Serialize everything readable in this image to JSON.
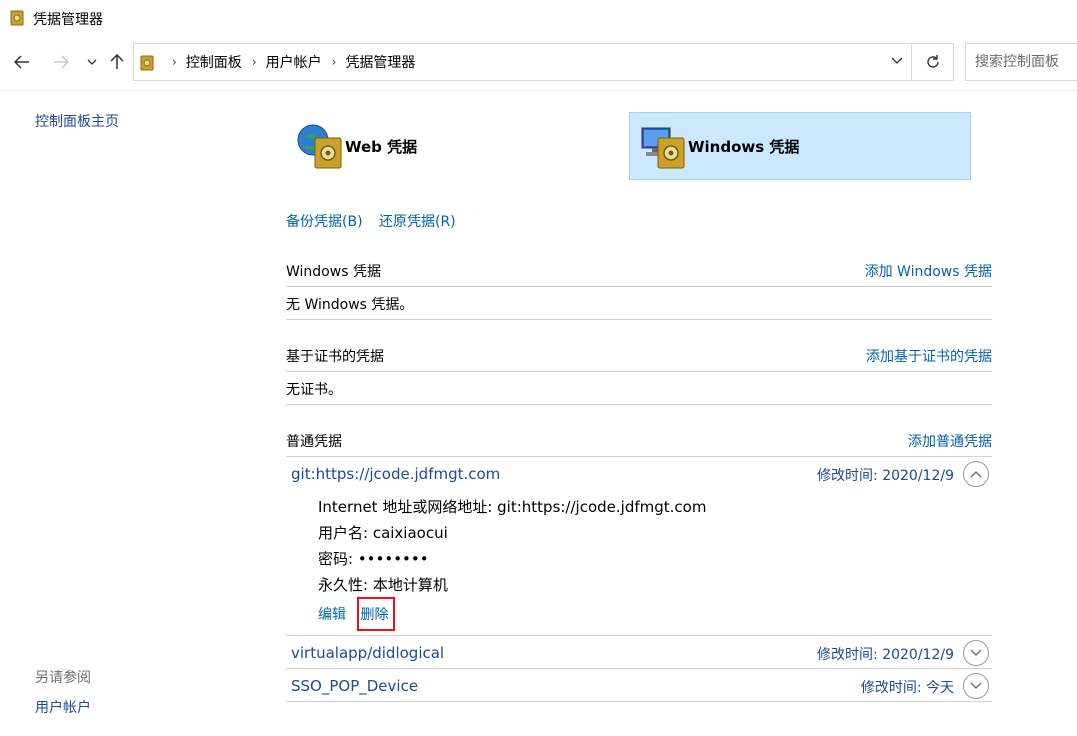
{
  "window": {
    "title": "凭据管理器"
  },
  "address": {
    "breadcrumbs": [
      "控制面板",
      "用户帐户",
      "凭据管理器"
    ],
    "search_placeholder": "搜索控制面板"
  },
  "left": {
    "home_link": "控制面板主页",
    "see_also_label": "另请参阅",
    "see_also_link": "用户帐户"
  },
  "tiles": {
    "web_label": "Web 凭据",
    "windows_label": "Windows 凭据"
  },
  "actions": {
    "backup": "备份凭据(B)",
    "restore": "还原凭据(R)"
  },
  "sections": {
    "windows": {
      "title": "Windows 凭据",
      "add": "添加 Windows 凭据",
      "empty": "无 Windows 凭据。"
    },
    "cert": {
      "title": "基于证书的凭据",
      "add": "添加基于证书的凭据",
      "empty": "无证书。"
    },
    "generic": {
      "title": "普通凭据",
      "add": "添加普通凭据"
    }
  },
  "credentials": [
    {
      "name": "git:https://jcode.jdfmgt.com",
      "modified": "修改时间:  2020/12/9",
      "expanded": true,
      "details": {
        "address": "Internet 地址或网络地址:  git:https://jcode.jdfmgt.com",
        "username": "用户名:  caixiaocui",
        "password": "密码:  ••••••••",
        "persistence": "永久性:  本地计算机"
      },
      "edit": "编辑",
      "delete": "删除"
    },
    {
      "name": "virtualapp/didlogical",
      "modified": "修改时间:  2020/12/9",
      "expanded": false
    },
    {
      "name": "SSO_POP_Device",
      "modified": "修改时间:  今天",
      "expanded": false
    }
  ],
  "colors": {
    "link": "#0063b1",
    "selected_tile": "#cce8ff",
    "highlight_box": "#e81123"
  }
}
